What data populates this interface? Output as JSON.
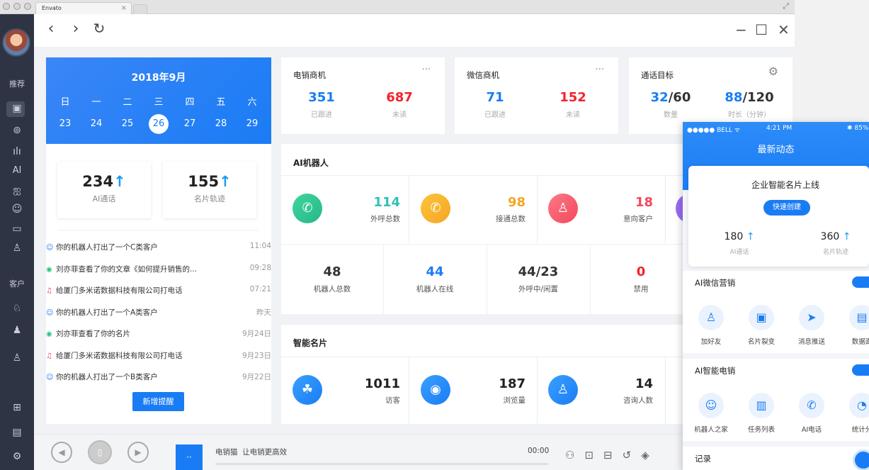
{
  "browser": {
    "tab_title": "Envato",
    "tab_close": "×",
    "expand_icon": "⤢"
  },
  "nav": {
    "back": "‹",
    "forward": "›",
    "reload": "↻",
    "minimize": "−",
    "maximize": "☐",
    "close": "✕"
  },
  "sidebar": {
    "section1": "推荐",
    "ai": "AI",
    "section2": "客户"
  },
  "calendar": {
    "title": "2018年9月",
    "weekdays": [
      "日",
      "一",
      "二",
      "三",
      "四",
      "五",
      "六"
    ],
    "days": [
      "23",
      "24",
      "25",
      "26",
      "27",
      "28",
      "29"
    ],
    "selected_index": 3
  },
  "stats": {
    "ai_calls": {
      "value": "234",
      "arrow": "↑",
      "label": "AI通话"
    },
    "card_track": {
      "value": "155",
      "arrow": "↑",
      "label": "名片轨迹"
    }
  },
  "feed": [
    {
      "icon": "robot-icon",
      "glyph": "☺",
      "color": "#1a7cf5",
      "text": "你的机器人打出了一个C类客户",
      "time": "11:04"
    },
    {
      "icon": "eye-icon",
      "glyph": "◉",
      "color": "#2ec27e",
      "text": "刘亦菲查看了你的文章《如何提升销售的...",
      "time": "09:28"
    },
    {
      "icon": "bell-icon",
      "glyph": "♫",
      "color": "#f5475b",
      "text": "给厦门多米诺数据科技有限公司打电话",
      "time": "07:21"
    },
    {
      "icon": "robot-icon",
      "glyph": "☺",
      "color": "#1a7cf5",
      "text": "你的机器人打出了一个A类客户",
      "time": "昨天"
    },
    {
      "icon": "eye-icon",
      "glyph": "◉",
      "color": "#2ec27e",
      "text": "刘亦菲查看了你的名片",
      "time": "9月24日"
    },
    {
      "icon": "bell-icon",
      "glyph": "♫",
      "color": "#f5475b",
      "text": "给厦门多米诺数据科技有限公司打电话",
      "time": "9月23日"
    },
    {
      "icon": "robot-icon",
      "glyph": "☺",
      "color": "#1a7cf5",
      "text": "你的机器人打出了一个B类客户",
      "time": "9月22日"
    }
  ],
  "new_reminder_button": "新增提醒",
  "cards": {
    "telesales": {
      "title": "电销商机",
      "more": "···",
      "v1": "351",
      "l1": "已跟进",
      "v2": "687",
      "l2": "未读"
    },
    "wechat": {
      "title": "微信商机",
      "more": "···",
      "v1": "71",
      "l1": "已跟进",
      "v2": "152",
      "l2": "未读"
    },
    "call_goal": {
      "title": "通话目标",
      "v1a": "32",
      "v1b": "/60",
      "l1": "数量",
      "v2a": "88",
      "v2b": "/120",
      "l2": "时长（分钟）"
    }
  },
  "ai_robot": {
    "title": "AI机器人",
    "metrics": [
      {
        "value": "114",
        "label": "外呼总数",
        "color": "#2ec2b5"
      },
      {
        "value": "98",
        "label": "接通总数",
        "color": "#f5a623"
      },
      {
        "value": "18",
        "label": "意向客户",
        "color": "#f5475b"
      }
    ],
    "bottom": [
      {
        "value": "48",
        "label": "机器人总数",
        "color": "#222"
      },
      {
        "value": "44",
        "label": "机器人在线",
        "color": "#1a7cf5"
      },
      {
        "value": "44/23",
        "label": "外呼中/闲置",
        "color": "#222"
      },
      {
        "value": "0",
        "label": "禁用",
        "color": "#f5222d"
      }
    ]
  },
  "smart_card": {
    "title": "智能名片",
    "metrics": [
      {
        "value": "1011",
        "label": "访客"
      },
      {
        "value": "187",
        "label": "浏览量"
      },
      {
        "value": "14",
        "label": "咨询人数"
      }
    ]
  },
  "player": {
    "title": "电销猫",
    "subtitle": "让电销更高效",
    "time": "00:00",
    "thumb": "··"
  },
  "phone": {
    "carrier": "●●●●● BELL ᯤ",
    "time": "4:21 PM",
    "battery": "✱ 85%",
    "title": "最新动态",
    "card_title": "企业智能名片上线",
    "quick_create": "快速创建",
    "ai_calls": {
      "value": "180",
      "arrow": "↑",
      "label": "AI通话"
    },
    "card_track": {
      "value": "360",
      "arrow": "↑",
      "label": "名片轨迹"
    },
    "sec1": {
      "title": "AI微信营销",
      "items": [
        "加好友",
        "名片裂变",
        "消息推送",
        "数据面"
      ]
    },
    "sec2": {
      "title": "AI智能电销",
      "items": [
        "机器人之家",
        "任务列表",
        "AI电话",
        "统计分"
      ]
    },
    "sec3": {
      "title": "记录"
    }
  }
}
